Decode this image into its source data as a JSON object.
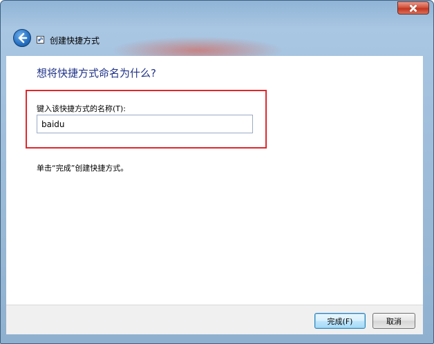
{
  "window": {
    "title": "创建快捷方式",
    "close_icon": "close-icon",
    "back_icon": "back-arrow-icon",
    "shortcut_icon": "shortcut-icon"
  },
  "content": {
    "heading": "想将快捷方式命名为什么?",
    "field_label": "键入该快捷方式的名称(T):",
    "name_value": "baidu",
    "hint": "单击“完成”创建快捷方式。"
  },
  "buttons": {
    "finish_label": "完成(F)",
    "cancel_label": "取消"
  },
  "colors": {
    "heading": "#1e3287",
    "highlight_border": "#e0262b",
    "frame": "#8fb4d6"
  }
}
